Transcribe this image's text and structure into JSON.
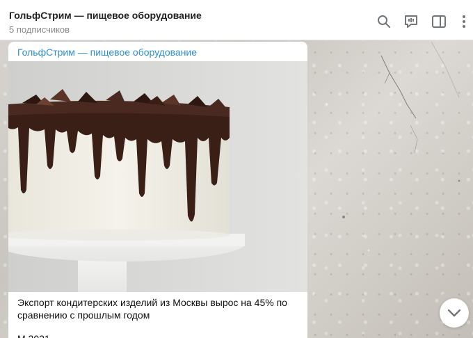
{
  "header": {
    "channel_title": "ГольфСтрим — пищевое оборудование",
    "subscribers": "5 подписчиков",
    "icons": [
      "search-icon",
      "discussion-icon",
      "sidebar-toggle-icon",
      "more-icon"
    ]
  },
  "message": {
    "author": "ГольфСтрим — пищевое оборудование",
    "headline": "Экспорт кондитерских изделий из Москвы вырос на 45% по сравнению с прошлым годом",
    "body_partial": "М 2021"
  },
  "colors": {
    "accent": "#2f8fcf",
    "header_bg": "#ffffff",
    "icon_gray": "#707579"
  },
  "scroll_button": {
    "icon": "chevron-down-icon"
  }
}
